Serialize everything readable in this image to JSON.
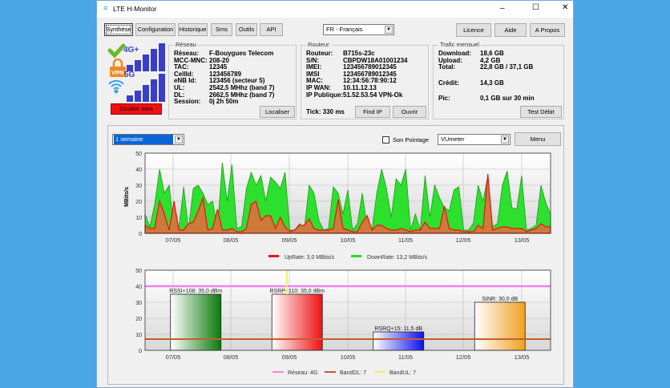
{
  "window": {
    "title": "LTE H-Monitor",
    "minimize": "–",
    "maximize": "☐",
    "close": "✕"
  },
  "tabs": [
    "Synthèse",
    "Configuration",
    "Historique",
    "Sms",
    "Outils",
    "API"
  ],
  "language": "FR - Français",
  "top_buttons": {
    "licence": "Licence",
    "aide": "Aide",
    "apropos": "A Propos"
  },
  "status": {
    "tech_top": "4G+",
    "tech_bottom": "5G",
    "vpn": "VPN",
    "disable_label": "Disable data",
    "disable_color": "#ee1111",
    "signal_bars_top": 5,
    "signal_bars_bottom": 5
  },
  "reseau": {
    "legend": "Réseau",
    "rows": [
      {
        "k": "Réseau:",
        "v": "F-Bouygues Telecom"
      },
      {
        "k": "MCC-MNC:",
        "v": "208-20"
      },
      {
        "k": "TAC:",
        "v": "12345"
      },
      {
        "k": "CellId:",
        "v": "123456789"
      },
      {
        "k": "eNB Id:",
        "v": "123456 (secteur 5)"
      },
      {
        "k": "UL:",
        "v": "2542,5 MHhz (band 7)"
      },
      {
        "k": "DL:",
        "v": "2662,5 MHhz (band 7)"
      },
      {
        "k": "Session:",
        "v": "0j 2h 50m"
      }
    ],
    "localiser": "Localiser"
  },
  "routeur": {
    "legend": "Routeur",
    "rows": [
      {
        "k": "Routeur:",
        "v": "B715s-23c"
      },
      {
        "k": "S/N:",
        "v": "CBPDW18A01001234"
      },
      {
        "k": "IMEI:",
        "v": "123456789012345"
      },
      {
        "k": "IMSI",
        "v": "123456789012345"
      },
      {
        "k": "MAC:",
        "v": "12:34:56:78:90:12"
      },
      {
        "k": "IP WAN:",
        "v": "10.11.12.13"
      },
      {
        "k": "IP Publique:",
        "v": "51.52.53.54 VPN-Ok"
      }
    ],
    "tick": "Tick: 330 ms",
    "find_ip": "Find IP",
    "ouvrir": "Ouvrir"
  },
  "trafic": {
    "legend": "Trafic mensuel",
    "rows": [
      {
        "k": "Download:",
        "v": "18,6 GB"
      },
      {
        "k": "Upload:",
        "v": "4,2 GB"
      },
      {
        "k": "Total:",
        "v": "22,8 GB / 37,1 GB"
      },
      {
        "k": "Crédit:",
        "v": "14,3 GB"
      },
      {
        "k": "Pic:",
        "v": "0,1 GB sur 30 min"
      }
    ],
    "test_debit": "Test Débit"
  },
  "graph_controls": {
    "period": "1 semaine",
    "son_pointage": "Son Pointage",
    "son_checked": false,
    "mode": "VUmeter",
    "menu": "Menu"
  },
  "chart_data": [
    {
      "type": "area",
      "ylabel": "MBits/s",
      "ylim": [
        0,
        50
      ],
      "yticks": [
        "0",
        "10",
        "20",
        "30",
        "40",
        "50"
      ],
      "x_range": [
        "06/05 13:00",
        "13/05 13:00"
      ],
      "xticks": [
        "07/05",
        "08/05",
        "09/05",
        "10/05",
        "11/05",
        "12/05",
        "13/05"
      ],
      "grid": true,
      "legend_position": "bottom",
      "series": [
        {
          "name": "DownRate: 13,2 MBits/s",
          "color": "#22dd22",
          "values": [
            12,
            4,
            18,
            40,
            25,
            30,
            2,
            3,
            29,
            2,
            28,
            30,
            25,
            18,
            20,
            3,
            44,
            20,
            43,
            3,
            4,
            28,
            38,
            30,
            36,
            20,
            35,
            32,
            28,
            38,
            2,
            2,
            6,
            3,
            30,
            25,
            8,
            2,
            3,
            29,
            25,
            12,
            27,
            2,
            6,
            25,
            4,
            2,
            25,
            40,
            28,
            10,
            34,
            30,
            40,
            2,
            12,
            2,
            36,
            10,
            30,
            22,
            16,
            14,
            27,
            29,
            2,
            2,
            6,
            30,
            20,
            36,
            4,
            6,
            30,
            39,
            16,
            15,
            36,
            2,
            3,
            5,
            30,
            19,
            12
          ]
        },
        {
          "name": "UpRate: 3,0 MBits/s",
          "color": "#ee1111",
          "values": [
            5,
            3,
            3,
            20,
            12,
            2,
            20,
            2,
            2,
            6,
            7,
            14,
            22,
            2,
            3,
            15,
            2,
            2,
            3,
            1,
            1,
            3,
            18,
            20,
            8,
            11,
            11,
            3,
            10,
            4,
            1,
            2,
            5,
            5,
            9,
            3,
            2,
            2,
            2,
            3,
            21,
            3,
            2,
            1,
            1,
            7,
            11,
            2,
            5,
            5,
            3,
            2,
            2,
            3,
            2,
            1,
            2,
            2,
            7,
            3,
            3,
            3,
            17,
            3,
            2,
            2,
            1,
            1,
            1,
            5,
            3,
            37,
            2,
            3,
            4,
            4,
            3,
            3,
            3,
            1,
            2,
            3,
            6,
            4,
            4
          ]
        }
      ]
    },
    {
      "type": "bar",
      "ylim": [
        0,
        50
      ],
      "yticks": [
        "0",
        "10",
        "20",
        "30",
        "40",
        "50"
      ],
      "xticks": [
        "07/05",
        "08/05",
        "09/05",
        "10/05",
        "11/05",
        "12/05",
        "13/05"
      ],
      "grid": true,
      "legend_position": "bottom",
      "bars": [
        {
          "label": "RSSI+108: 35,0 dBm",
          "value": 35.0,
          "color": "#0a7a0a"
        },
        {
          "label": "RSRP+110: 35,0 dBm",
          "value": 35.0,
          "color": "#ee1111"
        },
        {
          "label": "RSRQ+15: 11,5 dB",
          "value": 11.5,
          "color": "#1010ee"
        },
        {
          "label": "SINR: 30,0 dB",
          "value": 30.0,
          "color": "#f0a020"
        }
      ],
      "lines": [
        {
          "name": "Réseau: 4G",
          "value": 40,
          "color": "#ee82ee",
          "orientation": "horizontal"
        },
        {
          "name": "BandDL: 7",
          "value": 7,
          "color": "#c0602a",
          "orientation": "horizontal"
        },
        {
          "name": "BandUL: 7",
          "value": "09/05",
          "color": "#f5f060",
          "orientation": "vertical"
        }
      ]
    }
  ]
}
